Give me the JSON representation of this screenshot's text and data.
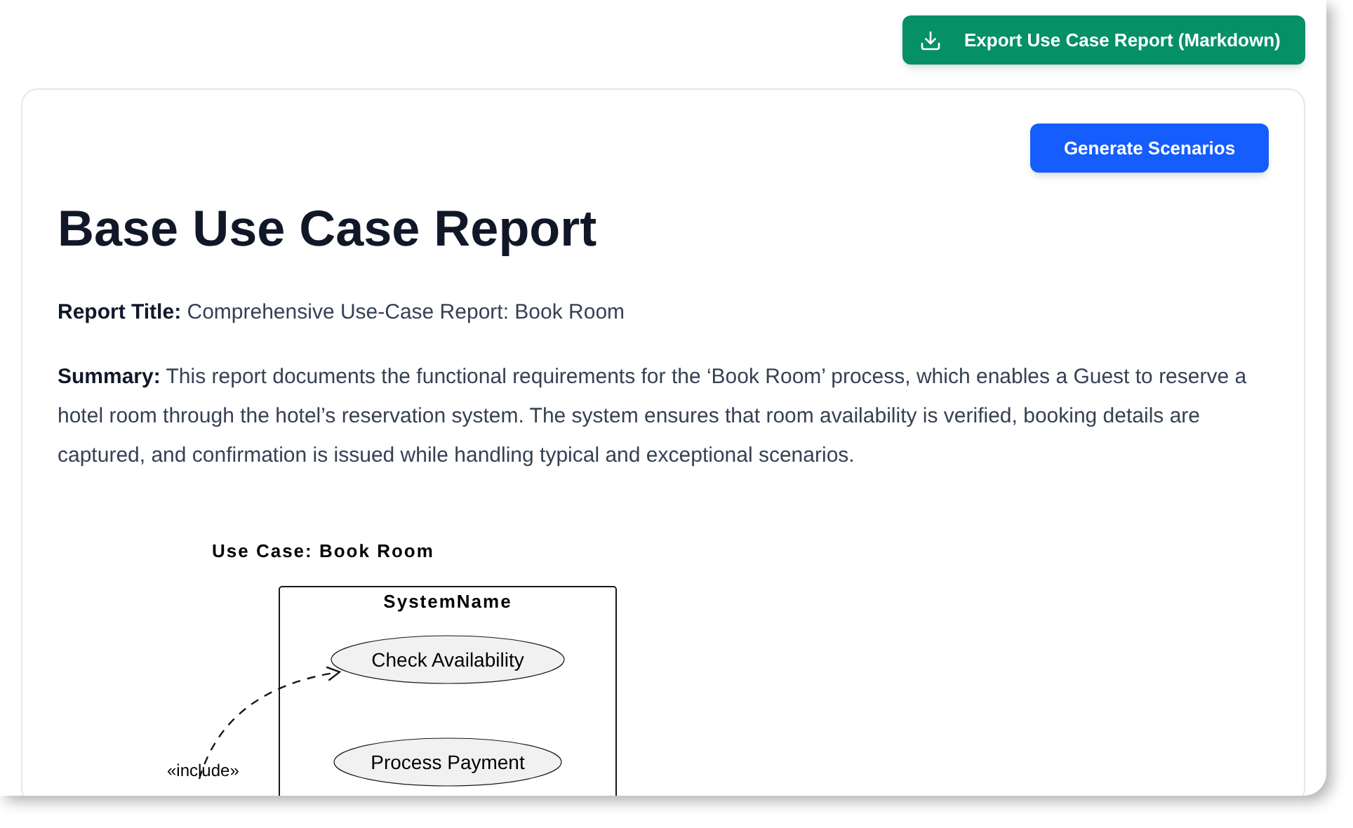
{
  "export_button": {
    "label": "Export Use Case Report (Markdown)"
  },
  "generate_button": {
    "label": "Generate Scenarios"
  },
  "heading": "Base Use Case Report",
  "report_title": {
    "label": "Report Title:",
    "value": "Comprehensive Use-Case Report: Book Room"
  },
  "summary": {
    "label": "Summary:",
    "value": "This report documents the functional requirements for the ‘Book Room’ process, which enables a Guest to reserve a hotel room through the hotel’s reservation system. The system ensures that room availability is verified, booking details are captured, and confirmation is issued while handling typical and exceptional scenarios."
  },
  "diagram": {
    "title": "Use Case: Book Room",
    "system_name": "SystemName",
    "use_cases": [
      "Check Availability",
      "Process Payment"
    ],
    "include_label": "«include»"
  }
}
